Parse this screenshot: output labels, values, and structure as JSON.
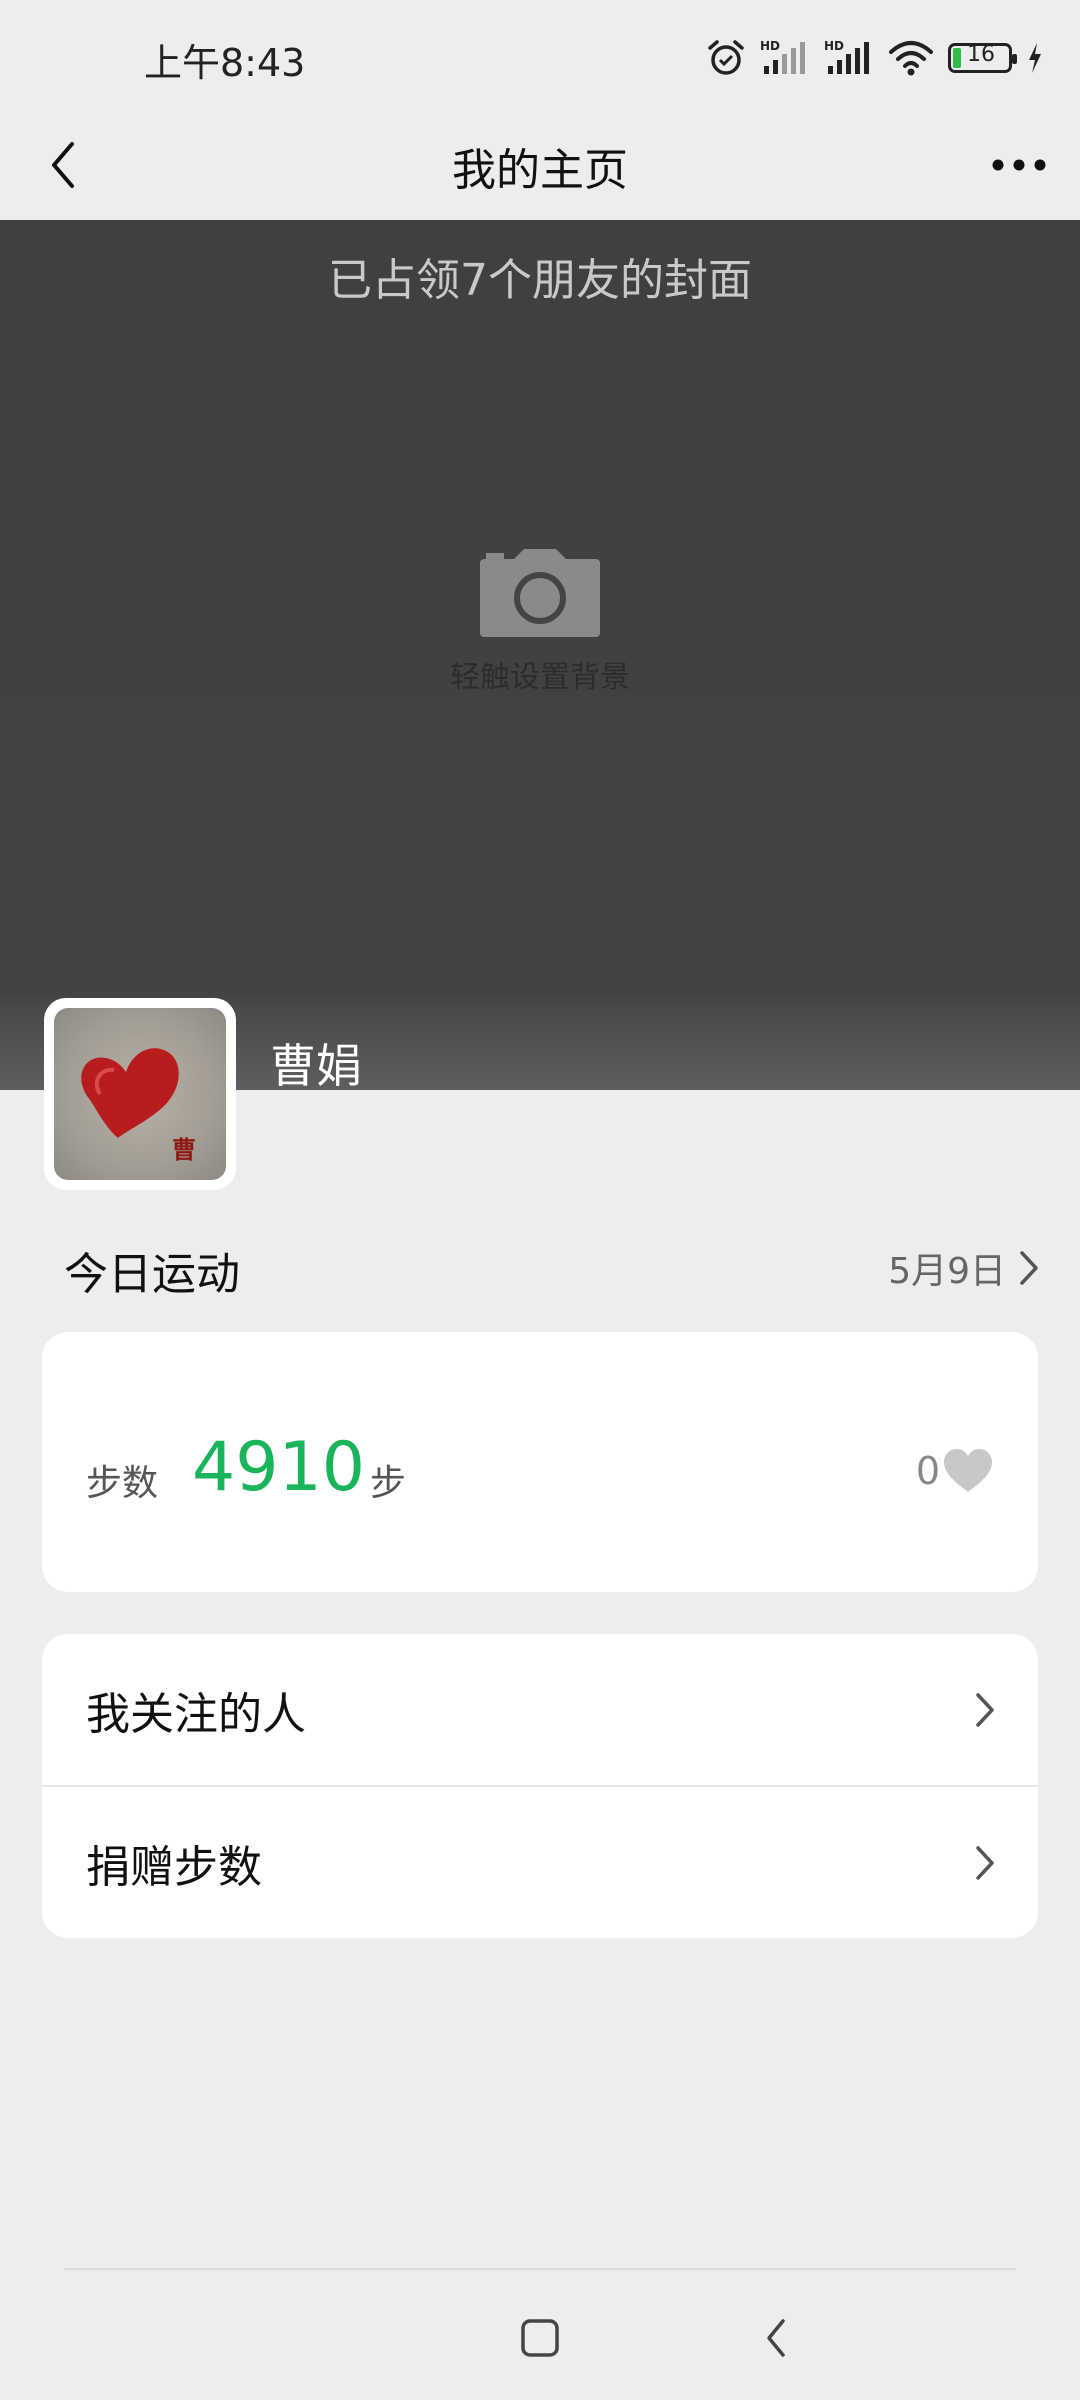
{
  "status_bar": {
    "time": "上午8:43",
    "battery_level": "16",
    "signal_label_1": "HD",
    "signal_label_2": "HD"
  },
  "header": {
    "title": "我的主页"
  },
  "cover": {
    "caption": "已占领7个朋友的封面",
    "hint": "轻触设置背景"
  },
  "profile": {
    "name": "曹娟",
    "avatar_mark": "曹"
  },
  "today": {
    "title": "今日运动",
    "date": "5月9日",
    "steps_label": "步数",
    "steps_value": "4910",
    "steps_unit": "步",
    "likes_count": "0"
  },
  "menu": {
    "items": [
      {
        "label": "我关注的人"
      },
      {
        "label": "捐赠步数"
      }
    ]
  },
  "colors": {
    "accent_green": "#1ab45a",
    "cover_bg": "#424242",
    "page_bg": "#ededed"
  },
  "icons": {
    "back": "chevron-left-icon",
    "more": "more-dots-icon",
    "camera": "camera-icon",
    "heart": "heart-icon",
    "chevron": "chevron-right-icon"
  }
}
